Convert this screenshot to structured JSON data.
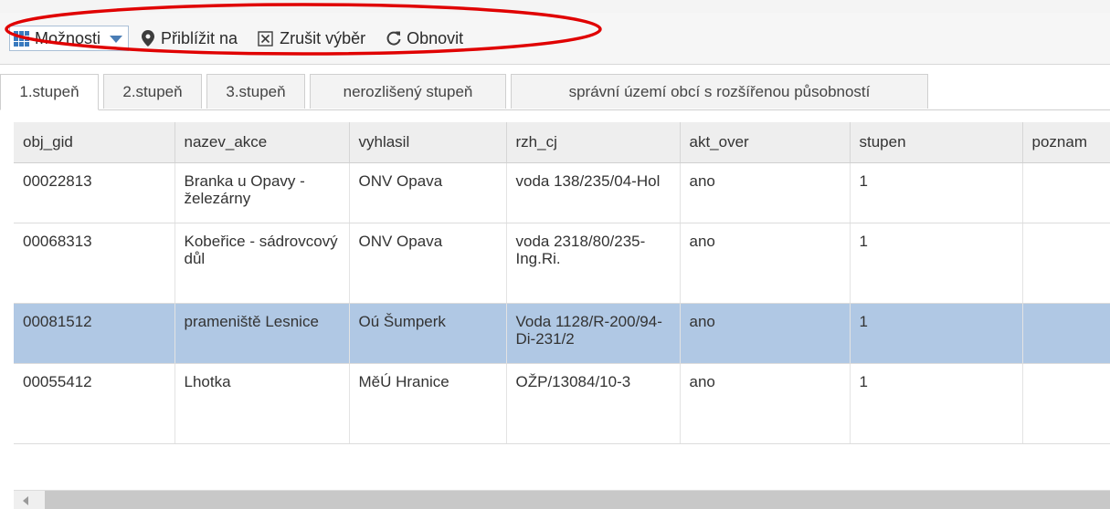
{
  "toolbar": {
    "options_label": "Možnosti",
    "zoom_label": "Přiblížit na",
    "clear_label": "Zrušit výběr",
    "refresh_label": "Obnovit"
  },
  "tabs": [
    {
      "label": "1.stupeň",
      "active": true
    },
    {
      "label": "2.stupeň",
      "active": false
    },
    {
      "label": "3.stupeň",
      "active": false
    },
    {
      "label": "nerozlišený stupeň",
      "active": false
    },
    {
      "label": "správní území obcí s rozšířenou působností",
      "active": false
    }
  ],
  "table": {
    "columns": [
      "obj_gid",
      "nazev_akce",
      "vyhlasil",
      "rzh_cj",
      "akt_over",
      "stupen",
      "poznam"
    ],
    "rows": [
      {
        "obj_gid": "00022813",
        "nazev_akce": "Branka u Opavy - železárny",
        "vyhlasil": "ONV Opava",
        "rzh_cj": "voda 138/235/04-Hol",
        "akt_over": "ano",
        "stupen": "1",
        "poznam": ""
      },
      {
        "obj_gid": "00068313",
        "nazev_akce": "Kobeřice - sádrovcový důl",
        "vyhlasil": "ONV Opava",
        "rzh_cj": "voda 2318/80/235-Ing.Ri.",
        "akt_over": "ano",
        "stupen": "1",
        "poznam": ""
      },
      {
        "obj_gid": "00081512",
        "nazev_akce": "prameniště Lesnice",
        "vyhlasil": "Oú Šumperk",
        "rzh_cj": "Voda 1128/R-200/94-Di-231/2",
        "akt_over": "ano",
        "stupen": "1",
        "poznam": ""
      },
      {
        "obj_gid": "00055412",
        "nazev_akce": "Lhotka",
        "vyhlasil": "MěÚ Hranice",
        "rzh_cj": "OŽP/13084/10-3",
        "akt_over": "ano",
        "stupen": "1",
        "poznam": ""
      }
    ]
  },
  "colors": {
    "selected_row": "#b0c8e4",
    "highlight_ellipse": "#e00000",
    "accent": "#3a7bbf"
  },
  "icons": {
    "options": "grid-icon",
    "zoom": "map-marker-icon",
    "clear": "checkbox-x-icon",
    "refresh": "refresh-icon"
  }
}
